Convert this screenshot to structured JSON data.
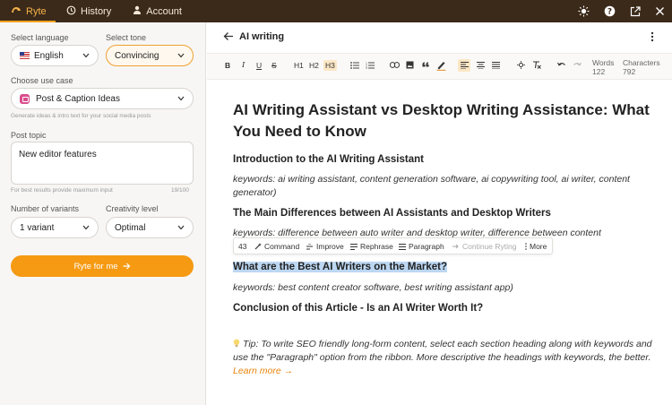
{
  "topbar": {
    "tabs": [
      {
        "label": "Ryte",
        "active": true
      },
      {
        "label": "History",
        "active": false
      },
      {
        "label": "Account",
        "active": false
      }
    ],
    "icons": [
      "sun-icon",
      "help-icon",
      "external-link-icon",
      "close-icon"
    ]
  },
  "sidebar": {
    "language_label": "Select language",
    "language_value": "English",
    "tone_label": "Select tone",
    "tone_value": "Convincing",
    "use_case_label": "Choose use case",
    "use_case_value": "Post & Caption Ideas",
    "use_case_help": "Generate ideas & intro text for your social media posts",
    "topic_label": "Post topic",
    "topic_value": "New editor features",
    "topic_help": "For best results provide maximum input",
    "topic_counter": "19/100",
    "variants_label": "Number of variants",
    "variants_value": "1 variant",
    "creativity_label": "Creativity level",
    "creativity_value": "Optimal",
    "primary_button": "Ryte for me"
  },
  "editor": {
    "title": "AI writing",
    "toolbar": {
      "bold": "B",
      "italic": "I",
      "underline": "U",
      "strike": "S",
      "h1": "H1",
      "h2": "H2",
      "h3": "H3",
      "words_label": "Words",
      "words_value": "122",
      "chars_label": "Characters",
      "chars_value": "792"
    },
    "heading": "AI Writing Assistant vs Desktop Writing Assistance: What You Need to Know",
    "sections": [
      {
        "heading": "Introduction to the AI Writing Assistant",
        "keywords": "keywords: ai writing assistant, content generation software, ai copywriting tool, ai writer, content generator)"
      },
      {
        "heading": "The Main Differences between AI Assistants and Desktop Writers",
        "keywords": "keywords: difference between auto writer and desktop writer, difference between content"
      },
      {
        "heading": "What are the Best AI Writers on the Market?",
        "keywords": "keywords: best content creator software, best writing assistant app)"
      },
      {
        "heading": "Conclusion of this Article - Is an AI Writer Worth It?"
      }
    ],
    "floating_toolbar": {
      "count": "43",
      "command": "Command",
      "improve": "Improve",
      "rephrase": "Rephrase",
      "paragraph": "Paragraph",
      "continue": "Continue Ryting",
      "more": "More"
    },
    "tip": "Tip: To write SEO friendly long-form content, select each section heading along with keywords and use the \"Paragraph\" option from the ribbon. More descriptive the headings with keywords, the better.",
    "learn_more": "Learn more →"
  },
  "colors": {
    "topbar_bg": "#3b2a1a",
    "accent": "#f59a12",
    "selection": "#bcd7f2"
  }
}
